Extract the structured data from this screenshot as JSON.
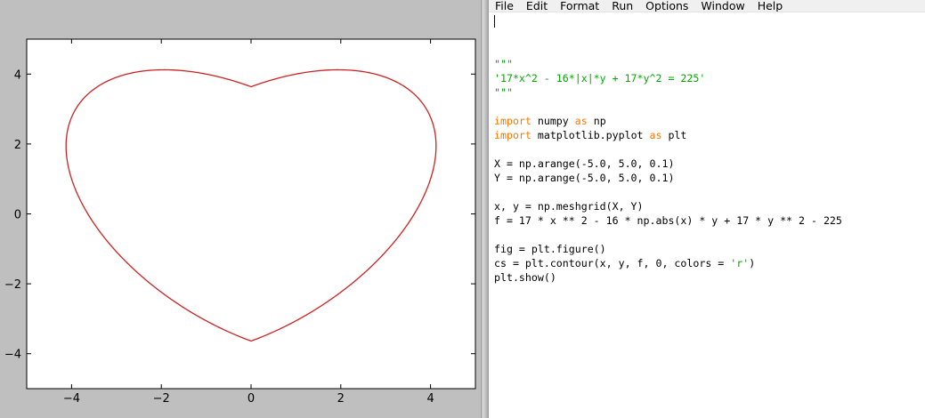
{
  "editor": {
    "menu": [
      "File",
      "Edit",
      "Format",
      "Run",
      "Options",
      "Window",
      "Help"
    ],
    "code_lines": [
      [
        {
          "t": "\"\"\"",
          "c": "str"
        }
      ],
      [
        {
          "t": "'17*x^2 - 16*|x|*y + 17*y^2 = 225'",
          "c": "str"
        }
      ],
      [
        {
          "t": "\"\"\"",
          "c": "str"
        }
      ],
      [],
      [
        {
          "t": "import",
          "c": "kw"
        },
        {
          "t": " numpy "
        },
        {
          "t": "as",
          "c": "kw"
        },
        {
          "t": " np"
        }
      ],
      [
        {
          "t": "import",
          "c": "kw"
        },
        {
          "t": " matplotlib.pyplot "
        },
        {
          "t": "as",
          "c": "kw"
        },
        {
          "t": " plt"
        }
      ],
      [],
      [
        {
          "t": "X = np.arange(-5.0, 5.0, 0.1)"
        }
      ],
      [
        {
          "t": "Y = np.arange(-5.0, 5.0, 0.1)"
        }
      ],
      [],
      [
        {
          "t": "x, y = np.meshgrid(X, Y)"
        }
      ],
      [
        {
          "t": "f = 17 * x ** 2 - 16 * np.abs(x) * y + 17 * y ** 2 - 225"
        }
      ],
      [],
      [
        {
          "t": "fig = plt.figure()"
        }
      ],
      [
        {
          "t": "cs = plt.contour(x, y, f, 0, colors = "
        },
        {
          "t": "'r'",
          "c": "str"
        },
        {
          "t": ")"
        }
      ],
      [
        {
          "t": "plt.show()"
        }
      ]
    ],
    "colors": {
      "string": "#00aa00",
      "keyword": "#ff7700",
      "text": "#000000"
    }
  },
  "chart_data": {
    "type": "line",
    "equation": "17*x^2 - 16*|x|*y + 17*y^2 = 225",
    "series": [
      {
        "color": "#cc2222",
        "level": 0
      }
    ],
    "xlim": [
      -5,
      5
    ],
    "ylim": [
      -5,
      5
    ],
    "x_ticks": [
      -4,
      -2,
      0,
      2,
      4
    ],
    "y_ticks": [
      -4,
      -2,
      0,
      2,
      4
    ],
    "x_tick_labels": [
      "−4",
      "−2",
      "0",
      "2",
      "4"
    ],
    "y_tick_labels": [
      "−4",
      "−2",
      "0",
      "2",
      "4"
    ],
    "title": "",
    "xlabel": "",
    "ylabel": "",
    "grid": false
  }
}
